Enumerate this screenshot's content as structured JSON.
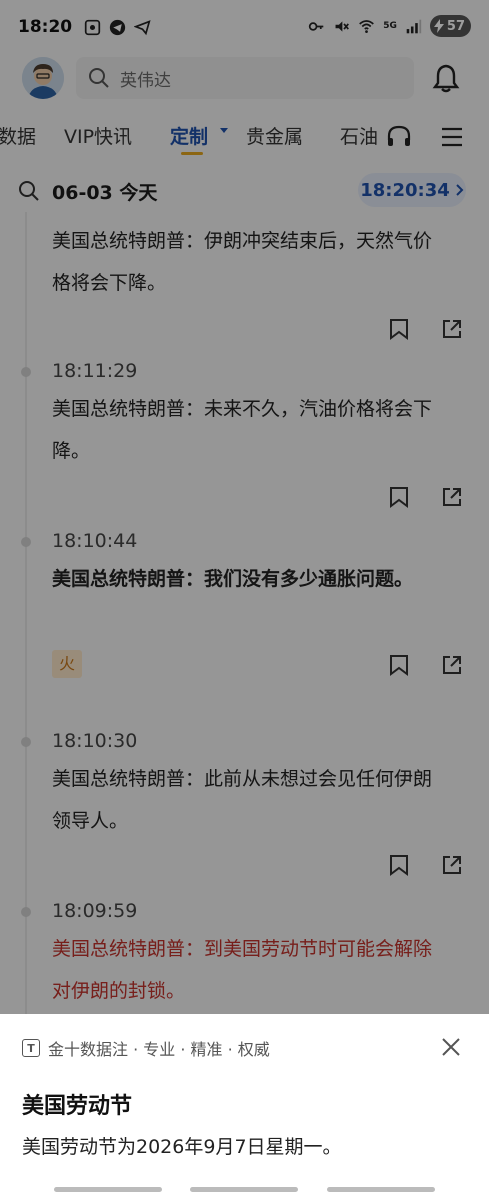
{
  "status_bar": {
    "time": "18:20",
    "battery": "57",
    "network": "5G"
  },
  "search": {
    "placeholder": "英伟达"
  },
  "tabs": [
    "数据",
    "VIP快讯",
    "定制",
    "贵金属",
    "石油"
  ],
  "date_row": {
    "date": "06-03 今天",
    "time": "18:20:34"
  },
  "feed": [
    {
      "time": "",
      "text": "美国总统特朗普：伊朗冲突结束后，天然气价格将会下降。"
    },
    {
      "time": "18:11:29",
      "text": "美国总统特朗普：未来不久，汽油价格将会下降。"
    },
    {
      "time": "18:10:44",
      "text": "美国总统特朗普：我们没有多少通胀问题。",
      "tag": "火"
    },
    {
      "time": "18:10:30",
      "text": "美国总统特朗普：此前从未想过会见任何伊朗领导人。"
    },
    {
      "time": "18:09:59",
      "text": "美国总统特朗普：到美国劳动节时可能会解除对伊朗的封锁。"
    }
  ],
  "sheet": {
    "source": "金十数据注 · 专业 · 精准 · 权威",
    "title": "美国劳动节",
    "body": "美国劳动节为2026年9月7日星期一。"
  },
  "colors": {
    "accent": "#1f4fa8",
    "highlight_red": "#c0322d",
    "tab_underline": "#e2a51f"
  }
}
